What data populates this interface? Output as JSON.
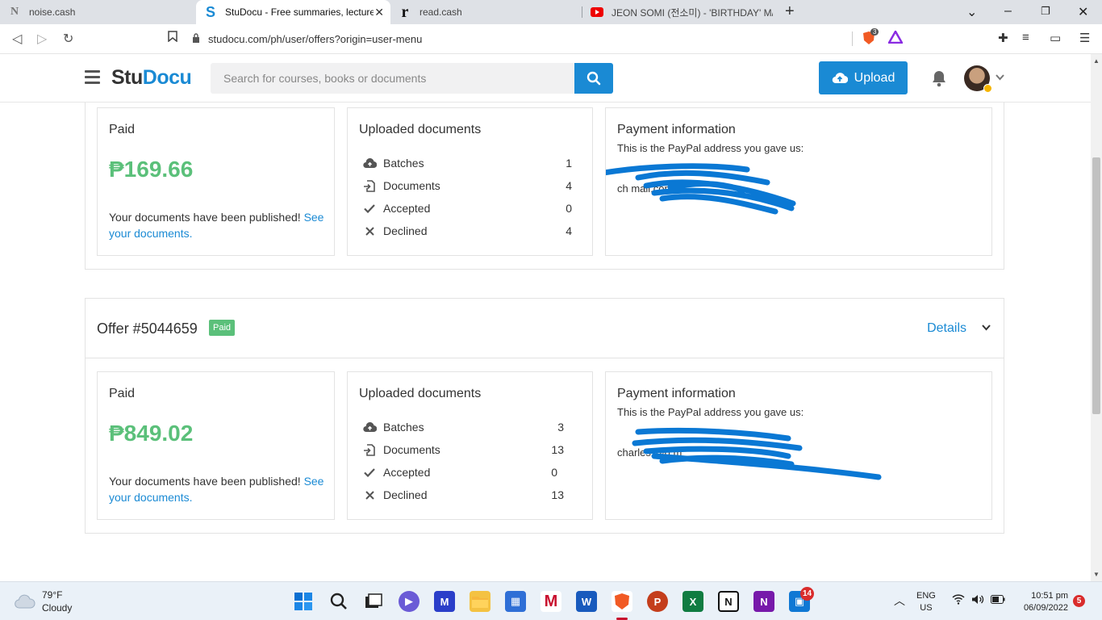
{
  "browser": {
    "tabs": [
      {
        "title": "noise.cash",
        "icon": "N"
      },
      {
        "title": "StuDocu - Free summaries, lecture",
        "icon": "S",
        "active": true
      },
      {
        "title": "read.cash",
        "icon": "r"
      },
      {
        "title": "JEON SOMI (전소미) - 'BIRTHDAY' M/V",
        "icon": "youtube"
      }
    ],
    "url": "studocu.com/ph/user/offers?origin=user-menu",
    "shield_badge": "3"
  },
  "header": {
    "logo_part1": "Stu",
    "logo_part2": "Docu",
    "search_placeholder": "Search for courses, books or documents",
    "upload_label": "Upload"
  },
  "offers": [
    {
      "paid_label": "Paid",
      "amount": "₱169.66",
      "published_text": "Your documents have been published!",
      "published_link": "See your documents.",
      "uploaded_title": "Uploaded documents",
      "stats": [
        {
          "label": "Batches",
          "value": "1",
          "icon": "cloud-upload-icon"
        },
        {
          "label": "Documents",
          "value": "4",
          "icon": "file-import-icon"
        },
        {
          "label": "Accepted",
          "value": "0",
          "icon": "check-icon"
        },
        {
          "label": "Declined",
          "value": "4",
          "icon": "x-icon"
        }
      ],
      "payment_title": "Payment information",
      "payment_sub": "This is the PayPal address you gave us:",
      "email_fragment": "ch                    mail.com"
    },
    {
      "offer_title": "Offer #5044659",
      "badge": "Paid",
      "details_label": "Details",
      "paid_label": "Paid",
      "amount": "₱849.02",
      "published_text": "Your documents have been published!",
      "published_link": "See your documents.",
      "uploaded_title": "Uploaded documents",
      "stats": [
        {
          "label": "Batches",
          "value": "3",
          "icon": "cloud-upload-icon"
        },
        {
          "label": "Documents",
          "value": "13",
          "icon": "file-import-icon"
        },
        {
          "label": "Accepted",
          "value": "0",
          "icon": "check-icon"
        },
        {
          "label": "Declined",
          "value": "13",
          "icon": "x-icon"
        }
      ],
      "payment_title": "Payment information",
      "payment_sub": "This is the PayPal address you gave us:",
      "email_fragment": "charles                @g        m"
    }
  ],
  "taskbar": {
    "temperature": "79°F",
    "condition": "Cloudy",
    "lang_top": "ENG",
    "lang_bottom": "US",
    "time": "10:51 pm",
    "date": "06/09/2022",
    "notif_count": "5",
    "app_badge": "14"
  },
  "colors": {
    "brand_blue": "#1a8ad4",
    "paid_green": "#5bc07a",
    "scribble_blue": "#0a78d4"
  }
}
